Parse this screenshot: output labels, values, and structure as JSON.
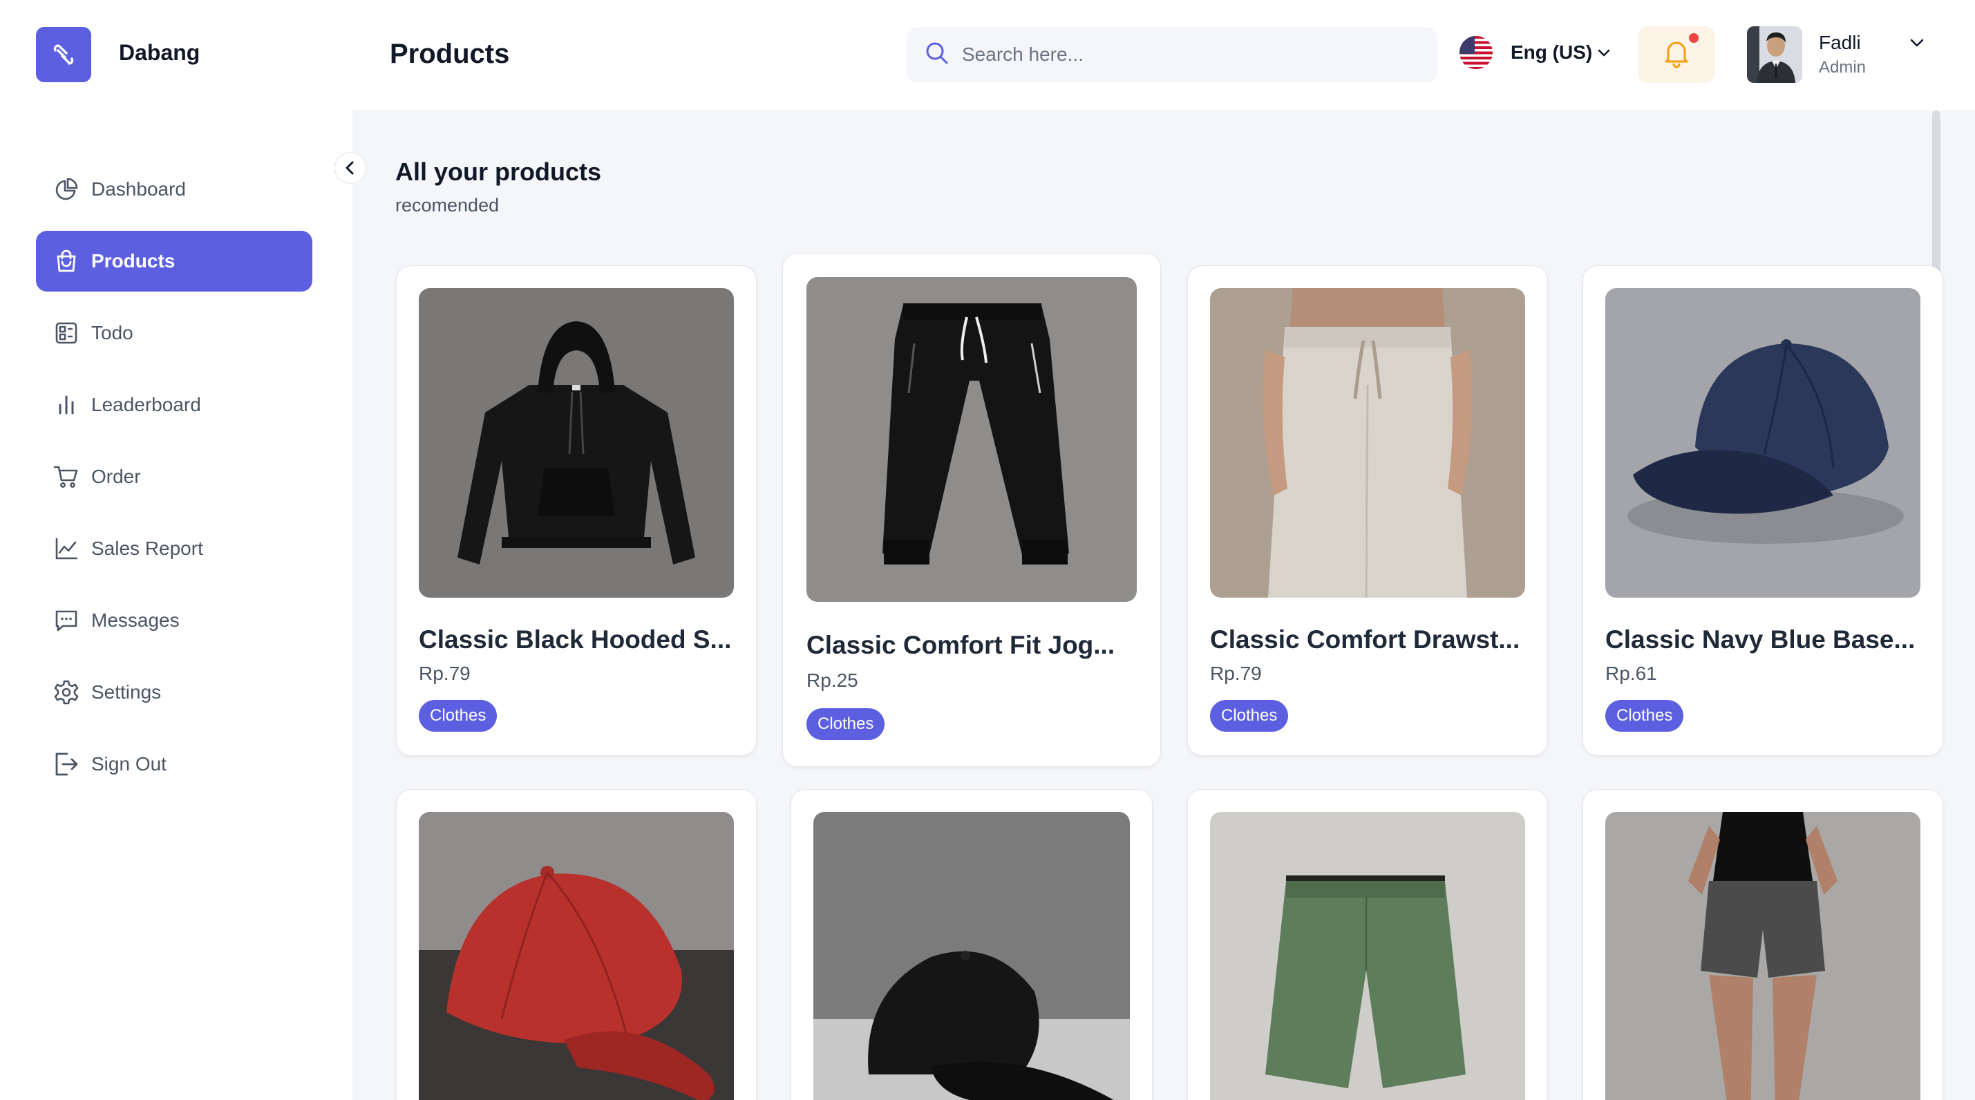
{
  "brand": {
    "name": "Dabang"
  },
  "header": {
    "title": "Products",
    "search_placeholder": "Search here...",
    "language": "Eng (US)",
    "user_name": "Fadli",
    "user_role": "Admin"
  },
  "sidebar": {
    "items": [
      {
        "label": "Dashboard",
        "icon": "pie-chart-icon"
      },
      {
        "label": "Products",
        "icon": "shopping-bag-icon",
        "active": true
      },
      {
        "label": "Todo",
        "icon": "checklist-icon"
      },
      {
        "label": "Leaderboard",
        "icon": "bar-chart-icon"
      },
      {
        "label": "Order",
        "icon": "cart-icon"
      },
      {
        "label": "Sales Report",
        "icon": "line-chart-icon"
      },
      {
        "label": "Messages",
        "icon": "message-icon"
      },
      {
        "label": "Settings",
        "icon": "gear-icon"
      },
      {
        "label": "Sign Out",
        "icon": "sign-out-icon"
      }
    ]
  },
  "section": {
    "title": "All your products",
    "subtitle": "recomended"
  },
  "products": [
    {
      "title": "Classic Black Hooded S...",
      "price": "Rp.79",
      "tag": "Clothes",
      "image": "black-hoodie"
    },
    {
      "title": "Classic Comfort Fit Jog...",
      "price": "Rp.25",
      "tag": "Clothes",
      "image": "black-joggers"
    },
    {
      "title": "Classic Comfort Drawst...",
      "price": "Rp.79",
      "tag": "Clothes",
      "image": "grey-drawstring-pants"
    },
    {
      "title": "Classic Navy Blue Base...",
      "price": "Rp.61",
      "tag": "Clothes",
      "image": "navy-baseball-cap"
    },
    {
      "title": "",
      "price": "",
      "tag": "",
      "image": "red-baseball-cap"
    },
    {
      "title": "",
      "price": "",
      "tag": "",
      "image": "black-baseball-cap"
    },
    {
      "title": "",
      "price": "",
      "tag": "",
      "image": "green-shorts"
    },
    {
      "title": "",
      "price": "",
      "tag": "",
      "image": "grey-athletic-shorts"
    }
  ],
  "colors": {
    "accent": "#5b5fe0",
    "background": "#f5f6fa",
    "notification": "#ef4444"
  }
}
